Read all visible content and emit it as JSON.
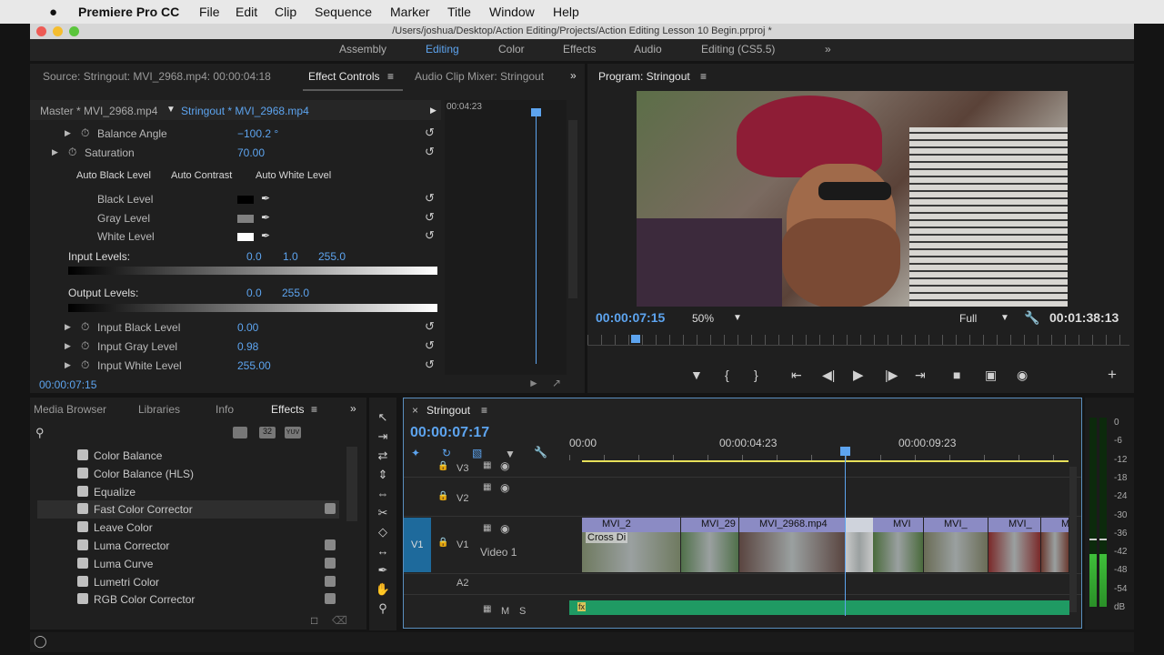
{
  "menu": {
    "apple": "",
    "app": "Premiere Pro CC",
    "items": [
      "File",
      "Edit",
      "Clip",
      "Sequence",
      "Marker",
      "Title",
      "Window",
      "Help"
    ]
  },
  "window": {
    "title": "/Users/joshua/Desktop/Action Editing/Projects/Action Editing Lesson 10 Begin.prproj *"
  },
  "workspaces": {
    "items": [
      "Assembly",
      "Editing",
      "Color",
      "Effects",
      "Audio",
      "Editing (CS5.5)"
    ],
    "active": "Editing",
    "more": "»"
  },
  "source_panel": {
    "tabs": [
      "Source: Stringout: MVI_2968.mp4: 00:00:04:18",
      "Effect Controls",
      "Audio Clip Mixer: Stringout"
    ],
    "active_tab": "Effect Controls",
    "menu_glyph": "≡",
    "more": "»",
    "master_clip": "Master * MVI_2968.mp4",
    "sequence_clip": "Stringout * MVI_2968.mp4",
    "mini_timecode": "00:04:23",
    "params": {
      "balance_angle": {
        "label": "Balance Angle",
        "value": "−100.2 °"
      },
      "saturation": {
        "label": "Saturation",
        "value": "70.00"
      },
      "auto_black": "Auto Black Level",
      "auto_contrast": "Auto Contrast",
      "auto_white": "Auto White Level",
      "black_level": "Black Level",
      "gray_level": "Gray Level",
      "white_level": "White Level",
      "input_levels": {
        "label": "Input Levels:",
        "v1": "0.0",
        "v2": "1.0",
        "v3": "255.0"
      },
      "output_levels": {
        "label": "Output Levels:",
        "v1": "0.0",
        "v2": "255.0"
      },
      "input_black": {
        "label": "Input Black Level",
        "value": "0.00"
      },
      "input_gray": {
        "label": "Input Gray Level",
        "value": "0.98"
      },
      "input_white": {
        "label": "Input White Level",
        "value": "255.00"
      }
    },
    "timecode": "00:00:07:15"
  },
  "program_panel": {
    "title": "Program: Stringout",
    "menu_glyph": "≡",
    "timecode": "00:00:07:15",
    "zoom": "50%",
    "quality": "Full",
    "duration": "00:01:38:13",
    "playhead_fraction": 0.08
  },
  "effects_panel": {
    "tabs": [
      "Media Browser",
      "Libraries",
      "Info",
      "Effects"
    ],
    "active_tab": "Effects",
    "menu_glyph": "≡",
    "more": "»",
    "badges": [
      "32",
      "YUV"
    ],
    "items": [
      "Color Balance",
      "Color Balance (HLS)",
      "Equalize",
      "Fast Color Corrector",
      "Leave Color",
      "Luma Corrector",
      "Luma Curve",
      "Lumetri Color",
      "RGB Color Corrector"
    ],
    "accelerated": [
      false,
      false,
      false,
      true,
      false,
      true,
      true,
      true,
      true
    ],
    "selected": "Fast Color Corrector"
  },
  "timeline": {
    "tab": "Stringout",
    "menu_glyph": "≡",
    "timecode": "00:00:07:17",
    "ruler": [
      "00:00",
      "00:00:04:23",
      "00:00:09:23"
    ],
    "tracks": {
      "v3": "V3",
      "v2": "V2",
      "v1_src": "V1",
      "v1": "V1",
      "v1_name": "Video 1",
      "a2": "A2",
      "m": "M",
      "s": "S"
    },
    "clips": [
      "MVI_2",
      "MVI_29",
      "MVI_2968.mp4",
      "MVI",
      "MVI_",
      "MVI_",
      "MVI"
    ],
    "transition": "Cross Di",
    "fx_badge": "fx"
  },
  "meter": {
    "labels": [
      "0",
      "-6",
      "-12",
      "-18",
      "-24",
      "-30",
      "-36",
      "-42",
      "-48",
      "-54",
      "dB"
    ],
    "level_fraction": 0.28
  },
  "colors": {
    "accent": "#5da4ef",
    "clip": "#8b8bc4",
    "audio": "#1f9a63",
    "v1_target": "#1e6a9c",
    "yellowline": "#e7e05a",
    "meter": "#3fbf3a"
  },
  "icons": [
    "apple-icon",
    "stopwatch-icon",
    "reset-icon",
    "eyedropper-icon",
    "search-icon",
    "play-icon",
    "wrench-icon",
    "marker-icon",
    "folder-icon",
    "trash-icon"
  ]
}
